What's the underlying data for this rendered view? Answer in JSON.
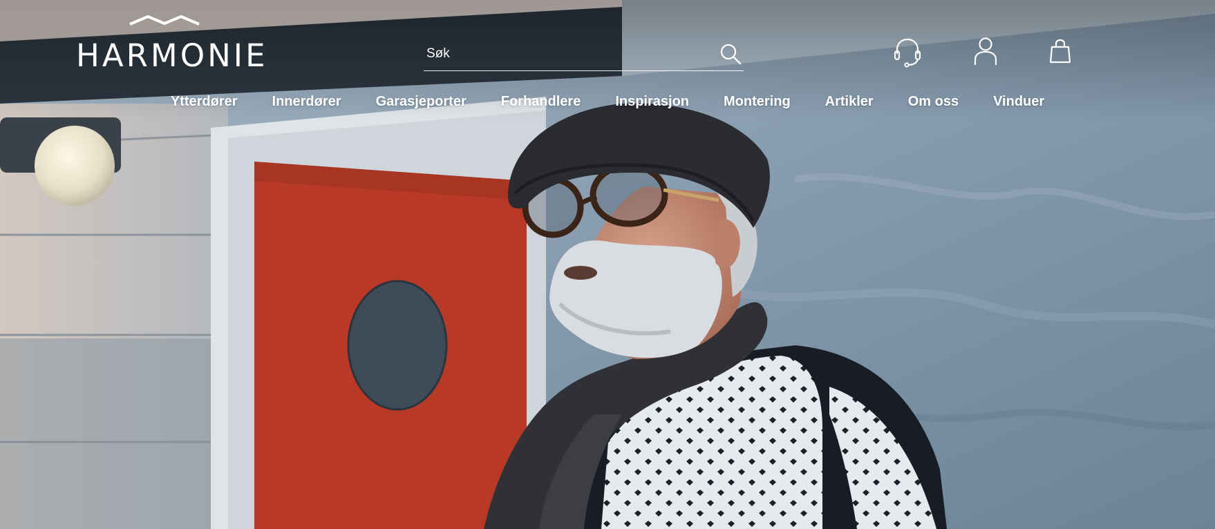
{
  "header": {
    "logo_text": "HARMONIE",
    "search": {
      "placeholder": "Søk",
      "value": ""
    },
    "icons": [
      "search-icon",
      "customer-service-headset-icon",
      "user-account-icon",
      "shopping-bag-icon"
    ]
  },
  "nav": {
    "items": [
      {
        "label": "Ytterdører"
      },
      {
        "label": "Innerdører"
      },
      {
        "label": "Garasjeporter"
      },
      {
        "label": "Forhandlere"
      },
      {
        "label": "Inspirasjon"
      },
      {
        "label": "Montering"
      },
      {
        "label": "Artikler"
      },
      {
        "label": "Om oss"
      },
      {
        "label": "Vinduer"
      }
    ]
  },
  "colors": {
    "nav_text": "#ffffff",
    "door_red": "#b83a26",
    "wall_blue": "#7f97aa"
  }
}
